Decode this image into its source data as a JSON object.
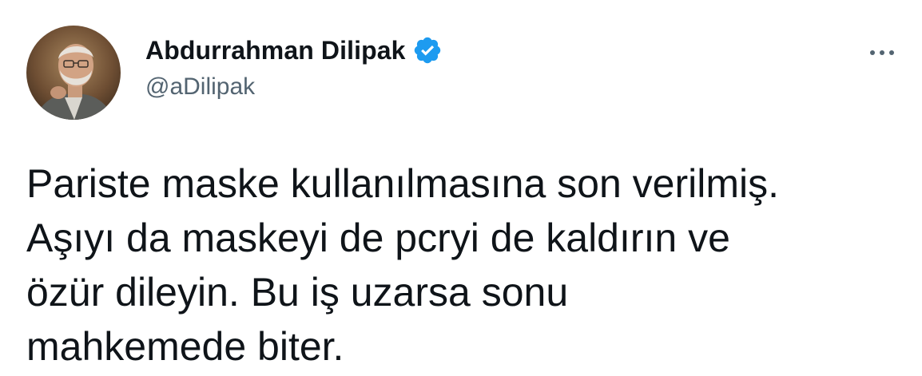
{
  "author": {
    "display_name": "Abdurrahman Dilipak",
    "handle": "@aDilipak",
    "verified": true,
    "verified_icon": "verified-badge-icon",
    "verified_color": "#1d9bf0",
    "avatar_icon": "profile-photo"
  },
  "menu": {
    "more_icon": "more-horizontal-icon"
  },
  "tweet": {
    "lines": [
      "Pariste maske kullanılmasına son verilmiş.",
      "Aşıyı da maskeyi de pcryi de kaldırın ve",
      "özür dileyin. Bu iş uzarsa sonu",
      "mahkemede biter."
    ]
  },
  "colors": {
    "text_primary": "#0f1419",
    "text_secondary": "#536471",
    "background": "#ffffff"
  }
}
